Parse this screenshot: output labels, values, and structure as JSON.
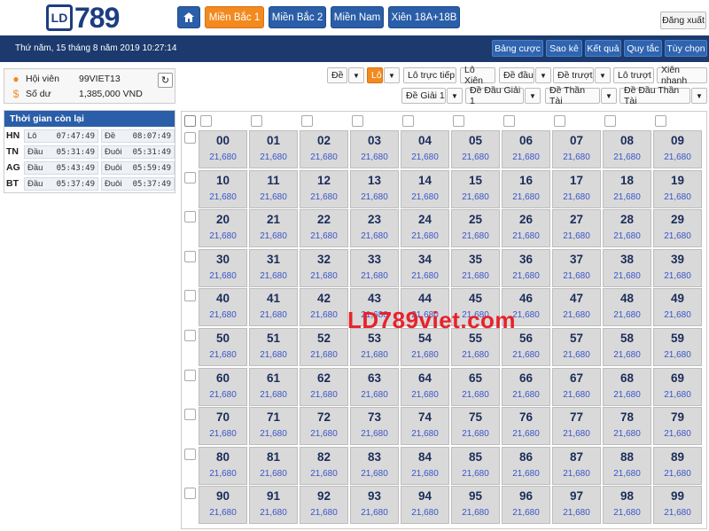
{
  "header": {
    "logo_ld": "LD",
    "logo_num": "789",
    "nav": [
      {
        "label": "Miền Bắc 1",
        "active": true
      },
      {
        "label": "Miền Bắc 2",
        "active": false
      },
      {
        "label": "Miền Nam",
        "active": false
      },
      {
        "label": "Xiên 18A+18B",
        "active": false
      }
    ],
    "logout_label": "Đăng xuất"
  },
  "status": {
    "datetime": "Thứ năm, 15 tháng 8 năm 2019 10:27:14",
    "buttons": [
      "Bảng cược",
      "Sao kê",
      "Kết quả",
      "Quy tắc",
      "Tùy chọn"
    ]
  },
  "member": {
    "member_label": "Hội viên",
    "member_value": "99VIET13",
    "balance_label": "Số dư",
    "balance_value": "1,385,000 VND"
  },
  "time_remaining": {
    "title": "Thời gian còn lại",
    "rows": [
      {
        "region": "HN",
        "l1": "Lô",
        "v1": "07:47:49",
        "l2": "Đề",
        "v2": "08:07:49"
      },
      {
        "region": "TN",
        "l1": "Đầu",
        "v1": "05:31:49",
        "l2": "Đuôi",
        "v2": "05:31:49"
      },
      {
        "region": "AG",
        "l1": "Đầu",
        "v1": "05:43:49",
        "l2": "Đuôi",
        "v2": "05:59:49"
      },
      {
        "region": "BT",
        "l1": "Đầu",
        "v1": "05:37:49",
        "l2": "Đuôi",
        "v2": "05:37:49"
      }
    ]
  },
  "filters": {
    "row1": [
      "Đề",
      "Lô",
      "Lô trực tiếp",
      "Lô Xiên",
      "Đề đầu",
      "Đề trượt",
      "Lô trượt",
      "Xiên nhanh"
    ],
    "row2": [
      "Đề Giải 1",
      "Đề Đầu Giải 1",
      "Đề Thần Tài",
      "Đề Đầu Thần Tài"
    ],
    "active": "Lô"
  },
  "grid": {
    "rate": "21,680",
    "numbers": [
      "00",
      "01",
      "02",
      "03",
      "04",
      "05",
      "06",
      "07",
      "08",
      "09",
      "10",
      "11",
      "12",
      "13",
      "14",
      "15",
      "16",
      "17",
      "18",
      "19",
      "20",
      "21",
      "22",
      "23",
      "24",
      "25",
      "26",
      "27",
      "28",
      "29",
      "30",
      "31",
      "32",
      "33",
      "34",
      "35",
      "36",
      "37",
      "38",
      "39",
      "40",
      "41",
      "42",
      "43",
      "44",
      "45",
      "46",
      "47",
      "48",
      "49",
      "50",
      "51",
      "52",
      "53",
      "54",
      "55",
      "56",
      "57",
      "58",
      "59",
      "60",
      "61",
      "62",
      "63",
      "64",
      "65",
      "66",
      "67",
      "68",
      "69",
      "70",
      "71",
      "72",
      "73",
      "74",
      "75",
      "76",
      "77",
      "78",
      "79",
      "80",
      "81",
      "82",
      "83",
      "84",
      "85",
      "86",
      "87",
      "88",
      "89",
      "90",
      "91",
      "92",
      "93",
      "94",
      "95",
      "96",
      "97",
      "98",
      "99"
    ]
  },
  "watermark": "LD789viet.com",
  "icons": {
    "home": "home-icon",
    "user": "user-icon",
    "dollar": "dollar-icon",
    "refresh": "refresh-icon"
  },
  "colors": {
    "accent": "#f28a1f",
    "primary": "#2a5ea8",
    "dark_bar": "#1c3a6e",
    "watermark": "#e8222b"
  }
}
